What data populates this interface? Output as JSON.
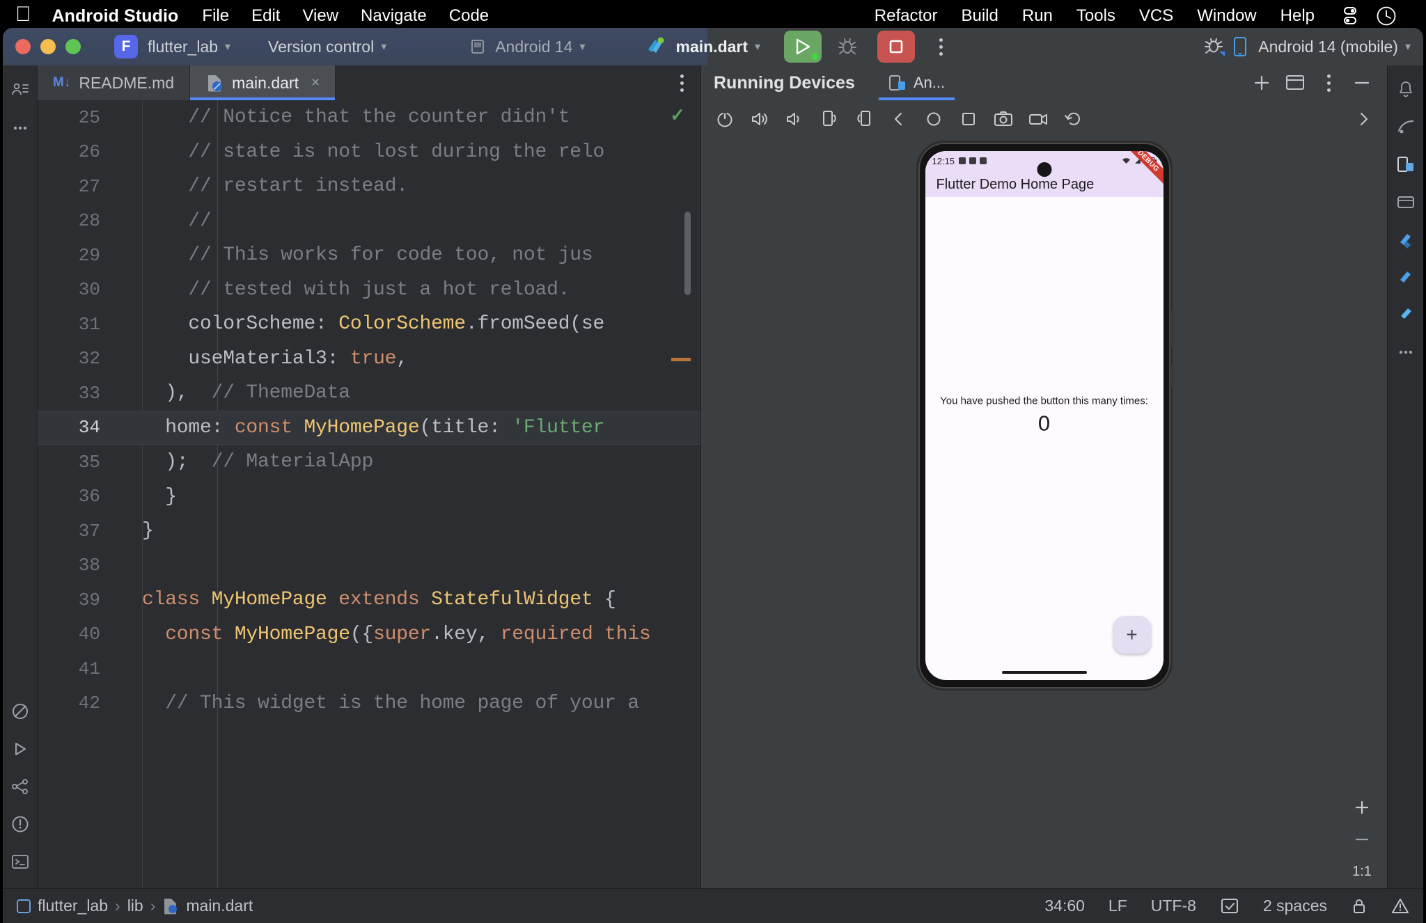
{
  "menubar": {
    "apple_icon": "apple-logo",
    "app_name": "Android Studio",
    "left_items": [
      "File",
      "Edit",
      "View",
      "Navigate",
      "Code"
    ],
    "right_items": [
      "Refactor",
      "Build",
      "Run",
      "Tools",
      "VCS",
      "Window",
      "Help"
    ],
    "control_center_icon": "control-center-icon",
    "clock_icon": "clock-icon"
  },
  "toolbar": {
    "project_initial": "F",
    "project_name": "flutter_lab",
    "version_control": "Version control",
    "device_config": "Android 14",
    "run_config": "main.dart",
    "run_icon": "run-play-icon",
    "debug_icon": "debug-bug-icon",
    "stop_icon": "stop-square-icon",
    "more_icon": "more-vertical-icon",
    "profiler_icon": "profiler-bug-icon",
    "device_selector": "Android 14 (mobile)",
    "device_icon": "phone-icon",
    "chevron": "⌄"
  },
  "tabs": [
    {
      "label": "README.md",
      "icon": "markdown-icon",
      "active": false
    },
    {
      "label": "main.dart",
      "icon": "dart-file-icon",
      "active": true,
      "close": "×"
    }
  ],
  "code": {
    "lines": [
      {
        "n": "25",
        "tokens": [
          {
            "t": "    // Notice that the counter didn't ",
            "c": "cmt"
          }
        ]
      },
      {
        "n": "26",
        "tokens": [
          {
            "t": "    // state is not lost during the relo",
            "c": "cmt"
          }
        ]
      },
      {
        "n": "27",
        "tokens": [
          {
            "t": "    // restart instead.",
            "c": "cmt"
          }
        ]
      },
      {
        "n": "28",
        "tokens": [
          {
            "t": "    //",
            "c": "cmt"
          }
        ]
      },
      {
        "n": "29",
        "tokens": [
          {
            "t": "    // This works for code too, not jus",
            "c": "cmt"
          }
        ]
      },
      {
        "n": "30",
        "tokens": [
          {
            "t": "    // tested with just a hot reload.",
            "c": "cmt"
          }
        ]
      },
      {
        "n": "31",
        "tokens": [
          {
            "t": "    colorScheme: ",
            "c": "pln"
          },
          {
            "t": "ColorScheme",
            "c": "typ"
          },
          {
            "t": ".fromSeed(se",
            "c": "pln"
          }
        ]
      },
      {
        "n": "32",
        "tokens": [
          {
            "t": "    useMaterial3: ",
            "c": "pln"
          },
          {
            "t": "true",
            "c": "kw"
          },
          {
            "t": ",",
            "c": "pln"
          }
        ]
      },
      {
        "n": "33",
        "tokens": [
          {
            "t": "  ),  ",
            "c": "pln"
          },
          {
            "t": "// ThemeData",
            "c": "cmt"
          }
        ]
      },
      {
        "n": "34",
        "tokens": [
          {
            "t": "  home: ",
            "c": "pln"
          },
          {
            "t": "const ",
            "c": "kw"
          },
          {
            "t": "MyHomePage",
            "c": "typ"
          },
          {
            "t": "(title: ",
            "c": "pln"
          },
          {
            "t": "'Flutter",
            "c": "str"
          }
        ],
        "highlight": true
      },
      {
        "n": "35",
        "tokens": [
          {
            "t": "  );  ",
            "c": "pln"
          },
          {
            "t": "// MaterialApp",
            "c": "cmt"
          }
        ]
      },
      {
        "n": "36",
        "tokens": [
          {
            "t": "  }",
            "c": "pln"
          }
        ]
      },
      {
        "n": "37",
        "tokens": [
          {
            "t": "}",
            "c": "pln"
          }
        ]
      },
      {
        "n": "38",
        "tokens": [
          {
            "t": "",
            "c": "pln"
          }
        ]
      },
      {
        "n": "39",
        "tokens": [
          {
            "t": "class ",
            "c": "kw"
          },
          {
            "t": "MyHomePage ",
            "c": "typ"
          },
          {
            "t": "extends ",
            "c": "kw"
          },
          {
            "t": "StatefulWidget ",
            "c": "typ"
          },
          {
            "t": "{",
            "c": "pln"
          }
        ]
      },
      {
        "n": "40",
        "tokens": [
          {
            "t": "  const ",
            "c": "kw"
          },
          {
            "t": "MyHomePage",
            "c": "typ"
          },
          {
            "t": "({",
            "c": "pln"
          },
          {
            "t": "super",
            "c": "kw"
          },
          {
            "t": ".key, ",
            "c": "pln"
          },
          {
            "t": "required ",
            "c": "kw"
          },
          {
            "t": "this",
            "c": "kw"
          }
        ]
      },
      {
        "n": "41",
        "tokens": [
          {
            "t": "",
            "c": "pln"
          }
        ]
      },
      {
        "n": "42",
        "tokens": [
          {
            "t": "  // This widget is the home page of your a",
            "c": "cmt"
          }
        ]
      }
    ]
  },
  "devices_panel": {
    "title": "Running Devices",
    "tab_label": "An...",
    "tab_icon": "emulator-icon",
    "add_icon": "plus-icon",
    "layout_icon": "split-layout-icon",
    "options_icon": "more-vertical-icon",
    "minimize_icon": "minimize-icon",
    "toolbar_icons": [
      "power-icon",
      "volume-up-icon",
      "volume-down-icon",
      "rotate-left-icon",
      "rotate-right-icon",
      "back-icon",
      "home-icon",
      "overview-icon",
      "screenshot-icon",
      "record-icon",
      "undo-icon",
      "chevron-right-icon"
    ],
    "zoom_in_icon": "zoom-in-icon",
    "zoom_out_icon": "zoom-out-icon",
    "zoom_actual": "1:1",
    "zoom_fit_icon": "zoom-fit-icon"
  },
  "emulator": {
    "status_time": "12:15",
    "debug_ribbon": "DEBUG",
    "app_bar_title": "Flutter Demo Home Page",
    "body_text": "You have pushed the button this many times:",
    "counter_value": "0",
    "fab_icon": "plus-icon",
    "fab_label": "+"
  },
  "statusbar": {
    "breadcrumb": [
      "flutter_lab",
      "lib",
      "main.dart"
    ],
    "separator": "›",
    "caret_position": "34:60",
    "line_ending": "LF",
    "encoding": "UTF-8",
    "indent": "2 spaces",
    "inspection_icon": "inspection-icon",
    "lock_icon": "lock-icon",
    "alert_icon": "alert-icon"
  },
  "colors": {
    "accent_blue": "#548af7",
    "run_green": "#6aa764",
    "stop_red": "#c75450",
    "toolbar_blue": "#3e4a63",
    "editor_bg": "#2b2d30",
    "panel_bg": "#3c3f41",
    "app_bar_purple": "#e9ddf7"
  }
}
